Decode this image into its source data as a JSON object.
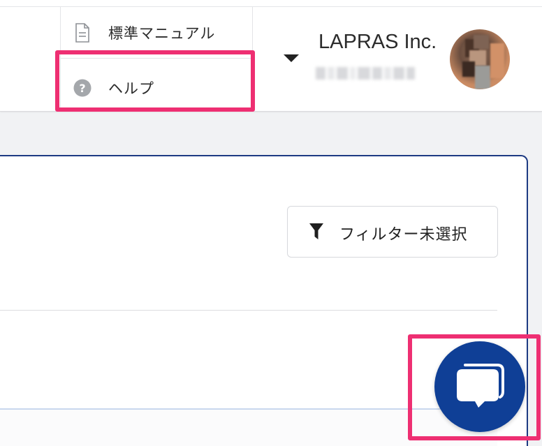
{
  "header": {
    "menu": {
      "manual": {
        "label": "標準マニュアル",
        "icon": "document-icon"
      },
      "help": {
        "label": "ヘルプ",
        "icon": "question-circle-icon"
      }
    },
    "account": {
      "company": "LAPRAS Inc.",
      "user_sub": "",
      "caret_icon": "caret-down-icon",
      "avatar": "avatar"
    }
  },
  "main": {
    "filter_button": {
      "label": "フィルター未選択",
      "icon": "filter-icon"
    }
  },
  "chat": {
    "icon": "chat-bubble-icon"
  },
  "colors": {
    "highlight": "#ee2f72",
    "primary": "#0f3f96",
    "panel_border": "#1d3a82"
  }
}
